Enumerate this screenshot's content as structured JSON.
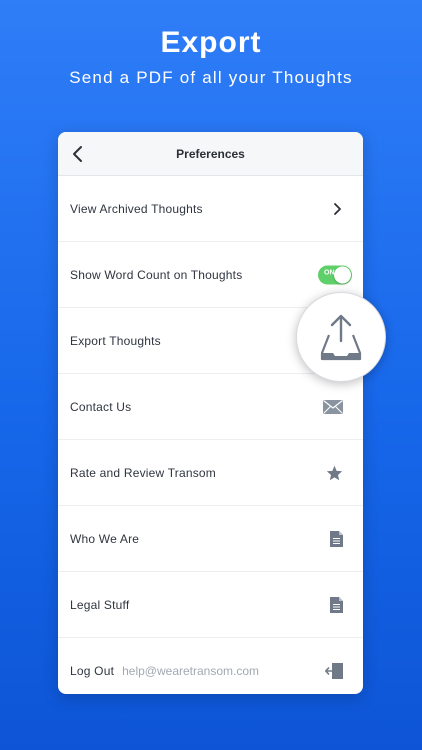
{
  "hero": {
    "title": "Export",
    "subtitle": "Send a PDF of all your Thoughts"
  },
  "nav": {
    "title": "Preferences",
    "back_icon": "chevron-left-icon"
  },
  "rows": [
    {
      "label": "View Archived Thoughts",
      "icon": "chevron-right-icon"
    },
    {
      "label": "Show Word Count on Thoughts",
      "toggle_state": "ON"
    },
    {
      "label": "Export Thoughts",
      "icon": "export-tray-icon"
    },
    {
      "label": "Contact Us",
      "icon": "envelope-icon"
    },
    {
      "label": "Rate and Review Transom",
      "icon": "star-icon"
    },
    {
      "label": "Who We Are",
      "icon": "document-icon"
    },
    {
      "label": "Legal Stuff",
      "icon": "document-icon"
    },
    {
      "label": "Log Out",
      "email": "help@wearetransom.com",
      "icon": "logout-icon"
    }
  ],
  "colors": {
    "background": "#1767ea",
    "toggle_on": "#5fd069",
    "icon_gray": "#6f7987"
  }
}
